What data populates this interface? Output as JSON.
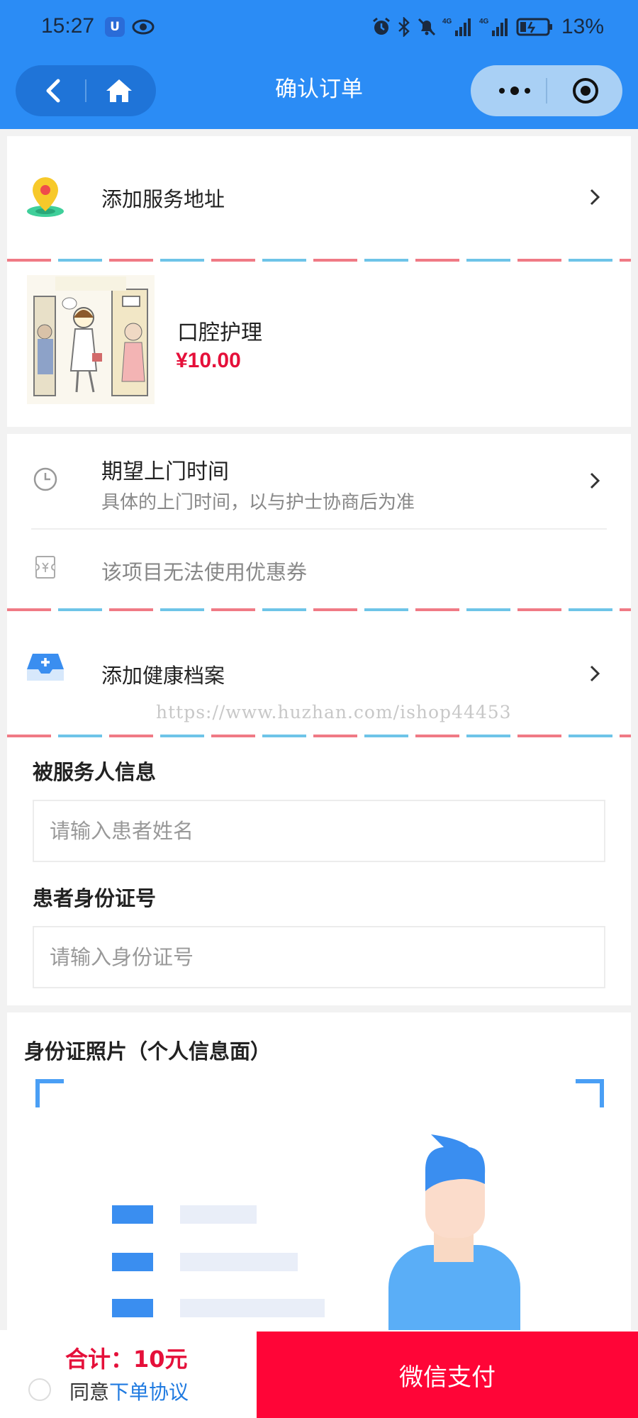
{
  "status_bar": {
    "time": "15:27",
    "app_icon_glyph": "U",
    "battery_percent": "13%",
    "network_1": "4G",
    "network_2": "4G"
  },
  "nav": {
    "title": "确认订单"
  },
  "address": {
    "label": "添加服务地址"
  },
  "product": {
    "name": "口腔护理",
    "price": "¥10.00"
  },
  "visit_time": {
    "title": "期望上门时间",
    "subtitle": "具体的上门时间，以与护士协商后为准"
  },
  "coupon": {
    "text": "该项目无法使用优惠券"
  },
  "health_record": {
    "label": "添加健康档案"
  },
  "watermark": "https://www.huzhan.com/ishop44453",
  "patient": {
    "name_label": "被服务人信息",
    "name_placeholder": "请输入患者姓名",
    "id_label": "患者身份证号",
    "id_placeholder": "请输入身份证号"
  },
  "id_photo": {
    "title": "身份证照片（个人信息面）"
  },
  "footer": {
    "total": "合计：10元",
    "agree_prefix": "同意",
    "agree_link": "下单协议",
    "pay_button": "微信支付"
  },
  "colors": {
    "header_blue": "#2b8cf5",
    "price_red": "#e5103a",
    "pay_red": "#ff0537",
    "link_blue": "#1f7ae0"
  }
}
